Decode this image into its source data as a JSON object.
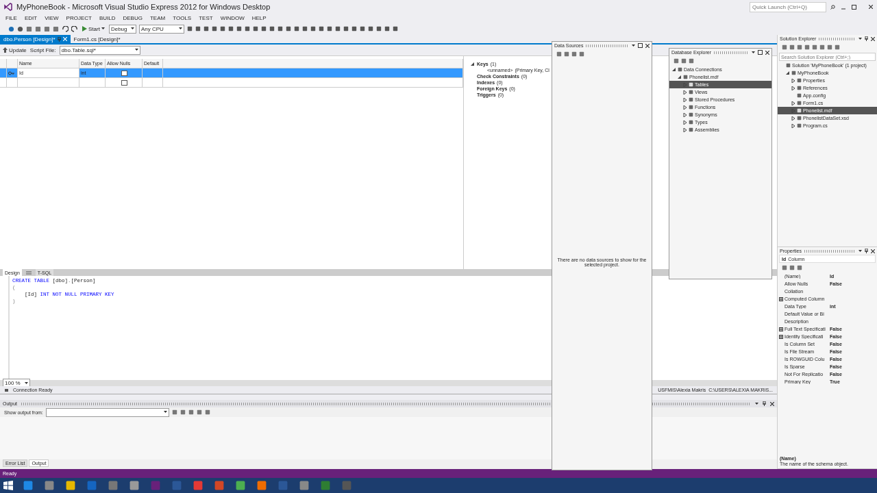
{
  "window": {
    "title": "MyPhoneBook - Microsoft Visual Studio Express 2012 for Windows Desktop",
    "quick_launch": {
      "placeholder": "Quick Launch (Ctrl+Q)"
    }
  },
  "menu": [
    "FILE",
    "EDIT",
    "VIEW",
    "PROJECT",
    "BUILD",
    "DEBUG",
    "TEAM",
    "TOOLS",
    "TEST",
    "WINDOW",
    "HELP"
  ],
  "toolbar": {
    "start": "Start",
    "configuration": "Debug",
    "platform": "Any CPU"
  },
  "document_tabs": [
    {
      "label": "dbo.Person [Design]*",
      "selected": true
    },
    {
      "label": "Form1.cs [Design]*",
      "selected": false
    }
  ],
  "designer_toolbar": {
    "update": "Update",
    "script_label": "Script File:",
    "script_value": "dbo.Table.sql*"
  },
  "columns_grid": {
    "headers": [
      "Name",
      "Data Type",
      "Allow Nulls",
      "Default"
    ],
    "rows": [
      {
        "name": "Id",
        "data_type": "int",
        "allow_nulls": false,
        "primary_key": true,
        "selected": true
      },
      {
        "allow_nulls": false,
        "primary_key": false,
        "selected": false
      }
    ]
  },
  "table_elements": [
    {
      "label": "Keys",
      "count": "(1)",
      "expanded": true,
      "children": [
        {
          "label": "<unnamed>",
          "detail": "(Primary Key, Cl"
        }
      ]
    },
    {
      "label": "Check Constraints",
      "count": "(0)"
    },
    {
      "label": "Indexes",
      "count": "(0)"
    },
    {
      "label": "Foreign Keys",
      "count": "(0)"
    },
    {
      "label": "Triggers",
      "count": "(0)"
    }
  ],
  "editor_tabs": [
    {
      "label": "Design",
      "selected": true
    },
    {
      "label": "T-SQL",
      "selected": false
    }
  ],
  "sql": [
    [
      {
        "text": "CREATE TABLE ",
        "kind": "keyword"
      },
      {
        "text": "[dbo]",
        "kind": "name"
      },
      {
        "text": ".",
        "kind": "punct"
      },
      {
        "text": "[Person]",
        "kind": "name"
      }
    ],
    [
      {
        "text": "(",
        "kind": "punct"
      }
    ],
    [
      {
        "text": "    [Id] ",
        "kind": "name"
      },
      {
        "text": "INT NOT NULL PRIMARY KEY",
        "kind": "keyword"
      }
    ],
    [
      {
        "text": ")",
        "kind": "punct"
      }
    ]
  ],
  "zoom": "100 %",
  "connection": {
    "status": "Connection Ready",
    "server": "USFMIS\\Alexia Makris",
    "database": "C:\\USERS\\ALEXIA MAKRIS..."
  },
  "output": {
    "title": "Output",
    "show_from": "Show output from:"
  },
  "bottom_tabs": [
    {
      "label": "Error List",
      "selected": false
    },
    {
      "label": "Output",
      "selected": true
    }
  ],
  "data_sources": {
    "title": "Data Sources",
    "message": "There are no data sources to show for the selected project."
  },
  "database_explorer": {
    "title": "Database Explorer",
    "tree": [
      {
        "label": "Data Connections",
        "expanded": true,
        "children": [
          {
            "label": "Phonelist.mdf",
            "expanded": true,
            "children": [
              {
                "label": "Tables",
                "expanded": false,
                "selected": true
              },
              {
                "label": "Views",
                "expanded": false,
                "selected": false
              },
              {
                "label": "Stored Procedures",
                "expanded": false,
                "selected": false
              },
              {
                "label": "Functions",
                "expanded": false,
                "selected": false
              },
              {
                "label": "Synonyms",
                "expanded": false,
                "selected": false
              },
              {
                "label": "Types",
                "expanded": false,
                "selected": false
              },
              {
                "label": "Assemblies",
                "expanded": false,
                "selected": false
              }
            ]
          }
        ]
      }
    ]
  },
  "solution_explorer": {
    "title": "Solution Explorer",
    "search": {
      "placeholder": "Search Solution Explorer (Ctrl+;)"
    },
    "tree": [
      {
        "label": "Solution 'MyPhoneBook' (1 project)",
        "children": [
          {
            "label": "MyPhoneBook",
            "expanded": true,
            "children": [
              {
                "label": "Properties",
                "expanded": false,
                "selected": false
              },
              {
                "label": "References",
                "expanded": false,
                "selected": false
              },
              {
                "label": "App.config",
                "selected": false
              },
              {
                "label": "Form1.cs",
                "expanded": false,
                "selected": false
              },
              {
                "label": "Phonelist.mdf",
                "expanded": false,
                "selected": true
              },
              {
                "label": "PhonelistDataSet.xsd",
                "expanded": false,
                "selected": false
              },
              {
                "label": "Program.cs",
                "expanded": false,
                "selected": false
              }
            ]
          }
        ]
      }
    ]
  },
  "properties": {
    "title": "Properties",
    "object": "Id",
    "object_type": "Column",
    "rows": [
      {
        "name": "(Name)",
        "value": "Id"
      },
      {
        "name": "Allow Nulls",
        "value": "False"
      },
      {
        "name": "Collation"
      },
      {
        "name": "Computed Column",
        "expanded": false
      },
      {
        "name": "Data Type",
        "value": "int"
      },
      {
        "name": "Default Value or Bi"
      },
      {
        "name": "Description"
      },
      {
        "name": "Full Text Specificati",
        "value": "False",
        "expanded": false
      },
      {
        "name": "Identity Specificati",
        "value": "False",
        "expanded": false
      },
      {
        "name": "Is Column Set",
        "value": "False"
      },
      {
        "name": "Is File Stream",
        "value": "False"
      },
      {
        "name": "Is ROWGUID Colu",
        "value": "False"
      },
      {
        "name": "Is Sparse",
        "value": "False"
      },
      {
        "name": "Not For Replicatio",
        "value": "False"
      },
      {
        "name": "Primary Key",
        "value": "True"
      }
    ],
    "description_title": "(Name)",
    "description": "The name of the schema object."
  },
  "status_bar": {
    "text": "Ready"
  }
}
